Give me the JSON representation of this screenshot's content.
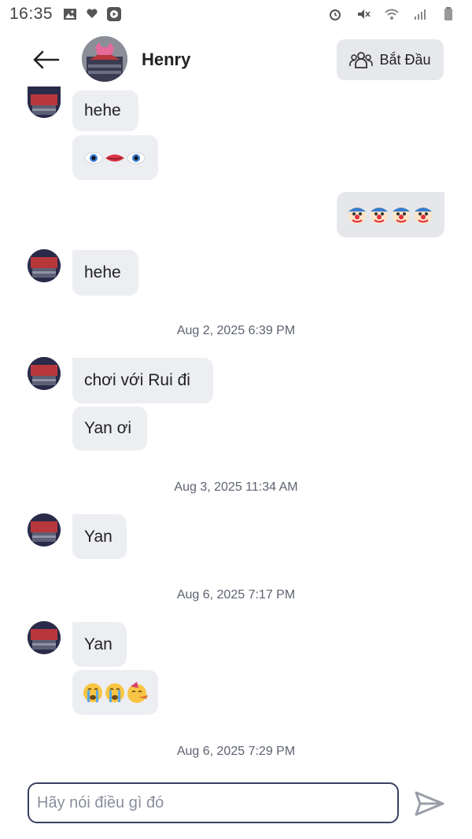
{
  "status_bar": {
    "time": "16:35"
  },
  "header": {
    "contact_name": "Henry",
    "start_button_label": "Bắt Đầu"
  },
  "messages": [
    {
      "text": "hehe"
    },
    {
      "emoji": "eyes-mouth"
    },
    {
      "emoji": "four-clown-faces"
    },
    {
      "text": "hehe"
    },
    {
      "text": "chơi với Rui đi"
    },
    {
      "text": "Yan ơi"
    },
    {
      "text": "Yan"
    },
    {
      "text": "Yan"
    },
    {
      "emoji": "crying-crying-party"
    }
  ],
  "timestamps": [
    "Aug 2, 2025 6:39 PM",
    "Aug 3, 2025 11:34 AM",
    "Aug 6, 2025 7:17 PM",
    "Aug 6, 2025 7:29 PM"
  ],
  "composer": {
    "placeholder": "Hãy nói điều gì đó"
  },
  "colors": {
    "bubble": "#eceef2",
    "text": "#222222",
    "timestamp": "#5d6270",
    "input_border": "#3a3f63",
    "send": "#9a9ea8"
  }
}
